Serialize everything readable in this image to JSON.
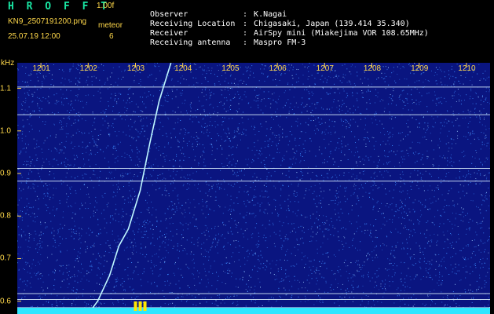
{
  "header": {
    "title": "H R O F F T",
    "version": "1.00f",
    "filename": "KN9_2507191200.png",
    "meteor_label": "meteor",
    "meteor_count": "6",
    "datetime": "25.07.19 12:00"
  },
  "metadata": [
    {
      "key": "Observer",
      "sep": ":",
      "value": "K.Nagai"
    },
    {
      "key": "Receiving Location",
      "sep": ":",
      "value": "Chigasaki, Japan (139.414 35.340)"
    },
    {
      "key": "Receiver",
      "sep": ":",
      "value": "AirSpy mini (Miakejima VOR 108.65MHz)"
    },
    {
      "key": "Receiving antenna",
      "sep": ":",
      "value": "Maspro FM-3"
    }
  ],
  "chart_data": {
    "type": "heatmap",
    "ylabel": "kHz",
    "x_ticks": [
      "1201",
      "1202",
      "1203",
      "1204",
      "1205",
      "1206",
      "1207",
      "1208",
      "1209",
      "1210"
    ],
    "x_range": [
      1200.5,
      1210.5
    ],
    "y_ticks": [
      "1.1",
      "1.0",
      "0.9",
      "0.8",
      "0.7",
      "0.6"
    ],
    "y_range": [
      0.57,
      1.16
    ],
    "horizontal_lines_khz": [
      1.103,
      1.038,
      0.912,
      0.882,
      0.618,
      0.604,
      0.585
    ],
    "meteor_trail": [
      {
        "x": 1202.0,
        "y": 0.57
      },
      {
        "x": 1202.2,
        "y": 0.6
      },
      {
        "x": 1202.45,
        "y": 0.66
      },
      {
        "x": 1202.65,
        "y": 0.73
      },
      {
        "x": 1202.85,
        "y": 0.77
      },
      {
        "x": 1203.1,
        "y": 0.86
      },
      {
        "x": 1203.3,
        "y": 0.97
      },
      {
        "x": 1203.5,
        "y": 1.07
      },
      {
        "x": 1203.75,
        "y": 1.16
      }
    ],
    "bursts_time": [
      1203.0,
      1203.1,
      1203.2
    ],
    "colors": {
      "background": "#0a1580",
      "noise": "#3c8cff",
      "line": "#dff4ff",
      "trail": "#bff7ff",
      "tick": "#ffd84a",
      "floor": "#2ee6ff",
      "burst": "#ffe600"
    }
  }
}
